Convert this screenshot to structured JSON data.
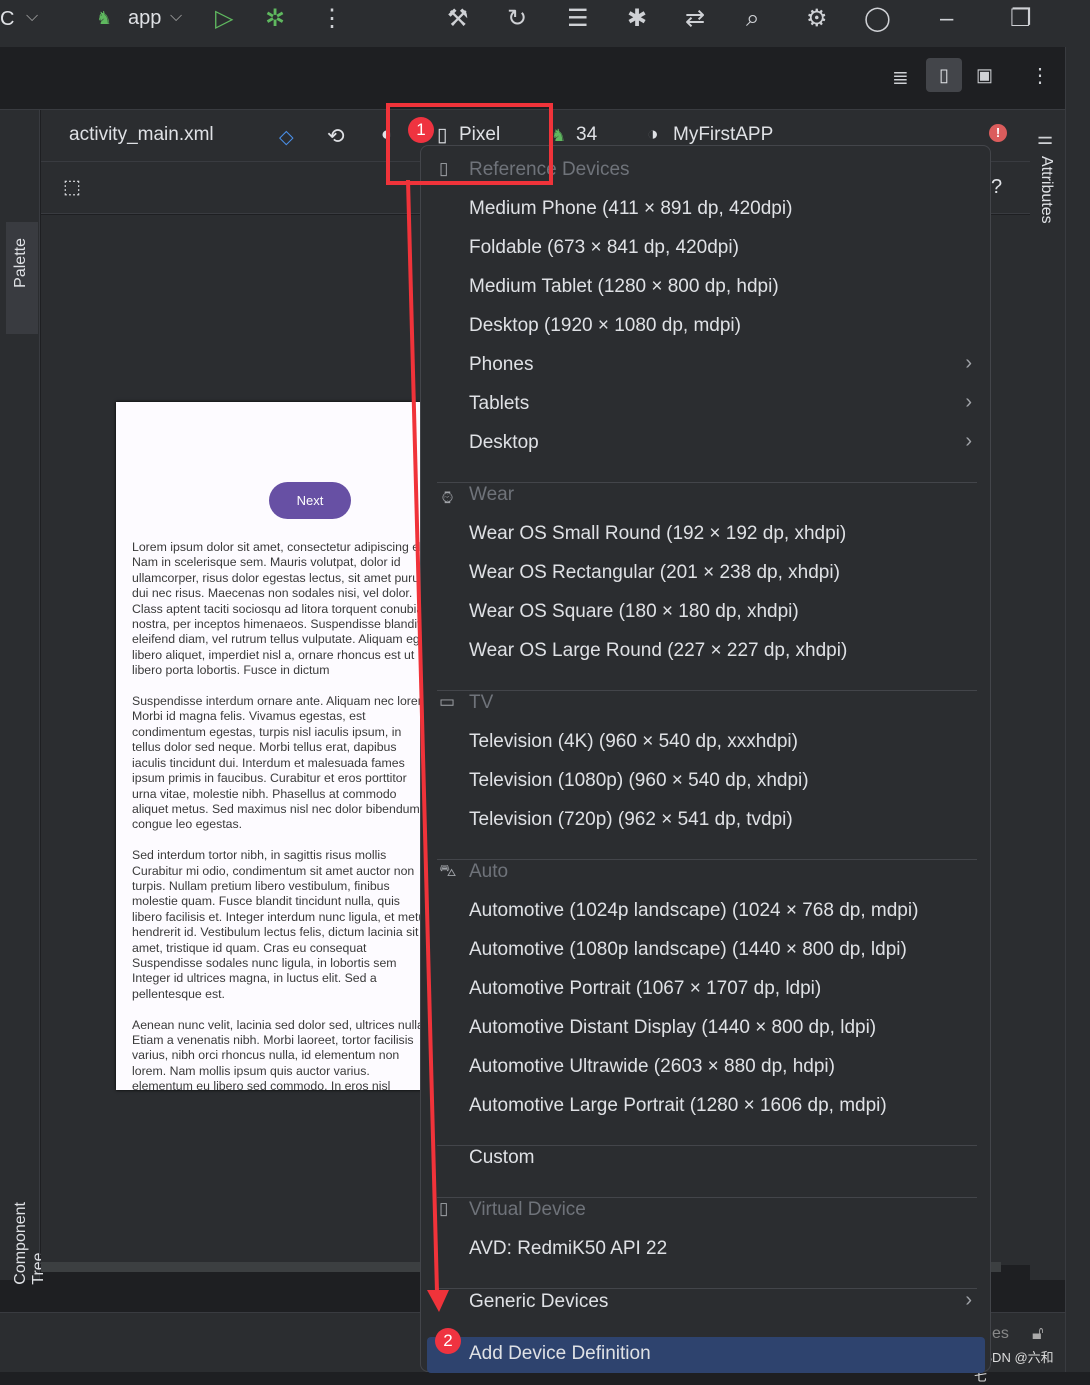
{
  "titlebar": {
    "project_initial": "C",
    "run_config": "app"
  },
  "design_toolbar": {
    "file": "activity_main.xml",
    "device": "Pixel",
    "api": "34",
    "theme": "MyFirstAPP"
  },
  "side_panels": {
    "palette": "Palette",
    "attributes": "Attributes",
    "component_tree": "Component Tree"
  },
  "preview": {
    "button_label": "Next",
    "button_color": "#6750a4",
    "body_text": "Lorem ipsum dolor sit amet, consectetur adipiscing elit. Nam in scelerisque sem. Mauris volutpat, dolor id ullamcorper, risus dolor egestas lectus, sit amet purus dui nec risus. Maecenas non sodales nisi, vel dolor. Class aptent taciti sociosqu ad litora torquent conubia nostra, per inceptos himenaeos. Suspendisse blandit eleifend diam, vel rutrum tellus vulputate. Aliquam eget libero aliquet, imperdiet nisl a, ornare rhoncus est ut libero porta lobortis. Fusce in dictum\n\n Suspendisse interdum ornare ante. Aliquam nec lorem. Morbi id magna felis. Vivamus egestas, est condimentum egestas, turpis nisl iaculis ipsum, in tellus dolor sed neque. Morbi tellus erat, dapibus iaculis tincidunt dui. Interdum et malesuada fames ipsum primis in faucibus. Curabitur et eros porttitor urna vitae, molestie nibh. Phasellus at commodo aliquet metus. Sed maximus nisl nec dolor bibendum congue leo egestas.\n\n Sed interdum tortor nibh, in sagittis risus mollis Curabitur mi odio, condimentum sit amet auctor non turpis. Nullam pretium libero vestibulum, finibus molestie quam. Fusce blandit tincidunt nulla, quis libero facilisis et. Integer interdum nunc ligula, et metus hendrerit id. Vestibulum lectus felis, dictum lacinia sit amet, tristique id quam. Cras eu consequat Suspendisse sodales nunc ligula, in lobortis sem Integer id ultrices magna, in luctus elit. Sed a pellentesque est.\n\n Aenean nunc velit, lacinia sed dolor sed, ultrices nulla. Etiam a venenatis nibh. Morbi laoreet, tortor facilisis varius, nibh orci rhoncus nulla, id elementum non lorem. Nam mollis ipsum quis auctor varius. elementum eu libero sed commodo. In eros nisl"
  },
  "menu": {
    "sections": [
      {
        "header": "Reference Devices",
        "icon": "phone-icon",
        "items": [
          {
            "label": "Medium Phone (411 × 891 dp, 420dpi)"
          },
          {
            "label": "Foldable (673 × 841 dp, 420dpi)"
          },
          {
            "label": "Medium Tablet (1280 × 800 dp, hdpi)"
          },
          {
            "label": "Desktop (1920 × 1080 dp, mdpi)"
          },
          {
            "label": "Phones",
            "submenu": true
          },
          {
            "label": "Tablets",
            "submenu": true
          },
          {
            "label": "Desktop",
            "submenu": true
          }
        ]
      },
      {
        "header": "Wear",
        "icon": "watch-icon",
        "items": [
          {
            "label": "Wear OS Small Round (192 × 192 dp, xhdpi)"
          },
          {
            "label": "Wear OS Rectangular (201 × 238 dp, xhdpi)"
          },
          {
            "label": "Wear OS Square (180 × 180 dp, xhdpi)"
          },
          {
            "label": "Wear OS Large Round (227 × 227 dp, xhdpi)"
          }
        ]
      },
      {
        "header": "TV",
        "icon": "tv-icon",
        "items": [
          {
            "label": "Television (4K) (960 × 540 dp, xxxhdpi)"
          },
          {
            "label": "Television (1080p) (960 × 540 dp, xhdpi)"
          },
          {
            "label": "Television (720p) (962 × 541 dp, tvdpi)"
          }
        ]
      },
      {
        "header": "Auto",
        "icon": "car-icon",
        "items": [
          {
            "label": "Automotive (1024p landscape) (1024 × 768 dp, mdpi)"
          },
          {
            "label": "Automotive (1080p landscape) (1440 × 800 dp, ldpi)"
          },
          {
            "label": "Automotive Portrait (1067 × 1707 dp, ldpi)"
          },
          {
            "label": "Automotive Distant Display (1440 × 800 dp, ldpi)"
          },
          {
            "label": "Automotive Ultrawide (2603 × 880 dp, hdpi)"
          },
          {
            "label": "Automotive Large Portrait (1280 × 1606 dp, mdpi)"
          }
        ]
      },
      {
        "header": "",
        "items": [
          {
            "label": "Custom"
          }
        ]
      },
      {
        "header": "Virtual Device",
        "icon": "phone-icon",
        "items": [
          {
            "label": "AVD: RedmiK50 API 22"
          }
        ]
      },
      {
        "header": "",
        "items": [
          {
            "label": "Generic Devices",
            "submenu": true
          }
        ]
      },
      {
        "header": "",
        "items": [
          {
            "label": "Add Device Definition",
            "selected": true
          }
        ]
      }
    ]
  },
  "annotations": {
    "step1": "1",
    "step2": "2",
    "color": "#f0333a"
  },
  "statusbar": {
    "partial": "es"
  },
  "watermark": "CSDN @六和七"
}
